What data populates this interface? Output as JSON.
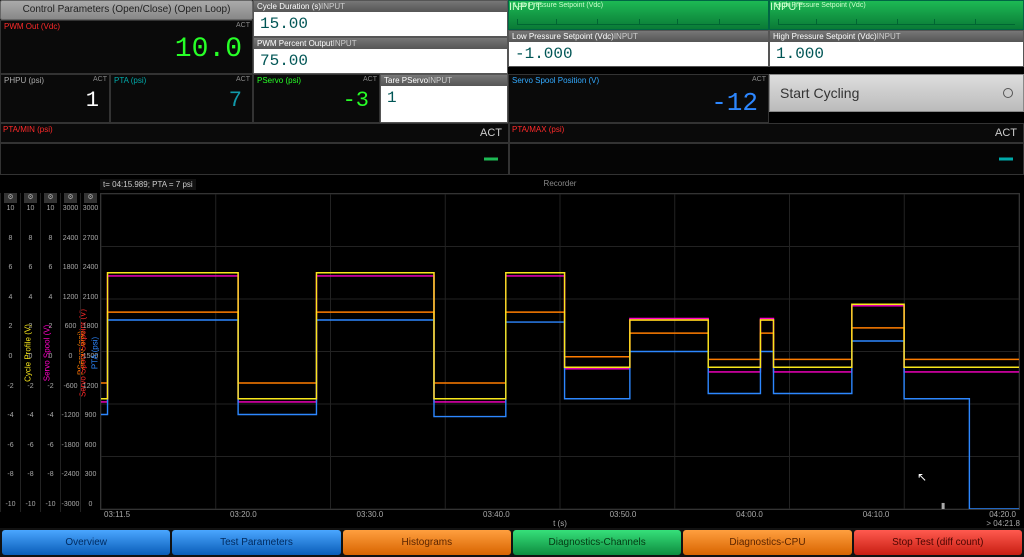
{
  "header_button": "Control Parameters (Open/Close) (Open Loop)",
  "panels": {
    "pwm_out": {
      "label": "PWM Out (Vdc)",
      "tag": "ACT",
      "value": "10.0"
    },
    "cycle_duration": {
      "label": "Cycle Duration (s)",
      "tag": "INPUT",
      "value": "15.00"
    },
    "pwm_percent": {
      "label": "PWM Percent Output",
      "tag": "INPUT",
      "value": "75.00"
    },
    "lp_setpoint_top": {
      "label": "Low Pressure Setpoint (Vdc)",
      "tag": "INPUT"
    },
    "lp_setpoint_bot": {
      "label": "Low Pressure Setpoint (Vdc)",
      "tag": "INPUT",
      "value": "-1.000"
    },
    "hp_setpoint_top": {
      "label": "High Pressure Setpoint (Vdc)",
      "tag": "INPUT"
    },
    "hp_setpoint_bot": {
      "label": "High Pressure Setpoint (Vdc)",
      "tag": "INPUT",
      "value": "1.000"
    },
    "phpu": {
      "label": "PHPU (psi)",
      "tag": "ACT",
      "value": "1"
    },
    "pta": {
      "label": "PTA (psi)",
      "tag": "ACT",
      "value": "7"
    },
    "pservo": {
      "label": "PServo (psi)",
      "tag": "ACT",
      "value": "-3"
    },
    "tare_pservo": {
      "label": "Tare PServo",
      "tag": "INPUT",
      "value": "1"
    },
    "servo_spool": {
      "label": "Servo Spool Position (V)",
      "tag": "ACT",
      "value": "-12"
    },
    "start_cycling": "Start Cycling",
    "ptamin": {
      "label": "PTA/MIN (psi)",
      "tag": "ACT"
    },
    "ptamax": {
      "label": "PTA/MAX (psi)",
      "tag": "ACT"
    }
  },
  "nav": [
    "Overview",
    "Test Parameters",
    "Histograms",
    "Diagnostics-Channels",
    "Diagnostics-CPU",
    "Stop Test (diff count)"
  ],
  "recorder": {
    "title": "Recorder",
    "cursor_label": "t= 04:15.989; PTA = 7 psi",
    "xlabel": "t (s)",
    "x_ticks": [
      "03:11.5",
      "03:20.0",
      "03:30.0",
      "03:40.0",
      "03:50.0",
      "04:00.0",
      "04:10.0",
      "04:20.0"
    ],
    "x_end": "> 04:21.8",
    "side_channels": [
      {
        "name": "Cycle Profile (V)",
        "color": "#f8e71c",
        "ticks": [
          "10",
          "8",
          "6",
          "4",
          "2",
          "0",
          "-2",
          "-4",
          "-6",
          "-8",
          "-10"
        ]
      },
      {
        "name": "Servo Spool (V)",
        "color": "#ff00c8",
        "ticks": [
          "10",
          "8",
          "6",
          "4",
          "2",
          "0",
          "-2",
          "-4",
          "-6",
          "-8",
          "-10"
        ]
      },
      {
        "name": "Servo Spool Setpoint (V)",
        "color": "#ff2a2a",
        "ticks": [
          "10",
          "8",
          "6",
          "4",
          "2",
          "0",
          "-2",
          "-4",
          "-6",
          "-8",
          "-10"
        ]
      },
      {
        "name": "PServo (psi)",
        "color": "#ff7d00",
        "ticks": [
          "3000",
          "2400",
          "1800",
          "1200",
          "600",
          "0",
          "-600",
          "-1200",
          "-1800",
          "-2400",
          "-3000"
        ]
      },
      {
        "name": "PTA (psi)",
        "color": "#2d87ff",
        "ticks": [
          "3000",
          "2700",
          "2400",
          "2100",
          "1800",
          "1500",
          "1200",
          "900",
          "600",
          "300",
          "0"
        ]
      }
    ]
  },
  "colors": {
    "bar_green": "#1db954",
    "bar_teal": "#0aa"
  },
  "chart_data": {
    "type": "line",
    "title": "Recorder",
    "xlabel": "t (s)",
    "xlim": [
      191.5,
      261.8
    ],
    "series": [
      {
        "name": "Cycle Profile (V)",
        "color": "#f8e71c",
        "ylim": [
          -10,
          10
        ],
        "points": [
          [
            191.5,
            -3
          ],
          [
            192,
            5
          ],
          [
            201,
            5
          ],
          [
            202,
            -3
          ],
          [
            207,
            -3
          ],
          [
            208,
            5
          ],
          [
            216,
            5
          ],
          [
            217,
            -3
          ],
          [
            221.5,
            -3
          ],
          [
            222.5,
            5
          ],
          [
            226,
            5
          ],
          [
            227,
            -1
          ],
          [
            231,
            -1
          ],
          [
            232,
            2
          ],
          [
            237,
            2
          ],
          [
            238,
            -1
          ],
          [
            242,
            2
          ],
          [
            243,
            -1
          ],
          [
            248,
            -1
          ],
          [
            249,
            3
          ],
          [
            252,
            3
          ],
          [
            253,
            -1
          ],
          [
            261.8,
            -1
          ]
        ]
      },
      {
        "name": "PTA (psi)",
        "color": "#2d87ff",
        "ylim": [
          0,
          3000
        ],
        "points": [
          [
            191.5,
            900
          ],
          [
            192,
            1800
          ],
          [
            201,
            1800
          ],
          [
            202,
            900
          ],
          [
            207,
            900
          ],
          [
            208,
            1800
          ],
          [
            216,
            1800
          ],
          [
            217,
            880
          ],
          [
            221.5,
            880
          ],
          [
            222.5,
            1780
          ],
          [
            226,
            1780
          ],
          [
            227,
            1050
          ],
          [
            231,
            1050
          ],
          [
            232,
            1500
          ],
          [
            237,
            1500
          ],
          [
            238,
            1100
          ],
          [
            242,
            1500
          ],
          [
            243,
            1100
          ],
          [
            248,
            1100
          ],
          [
            249,
            1600
          ],
          [
            252,
            1600
          ],
          [
            253,
            1050
          ],
          [
            255.989,
            1050
          ],
          [
            258,
            0
          ],
          [
            261.8,
            0
          ]
        ]
      },
      {
        "name": "PServo (psi)",
        "color": "#ff7d00",
        "ylim": [
          -3000,
          3000
        ],
        "points": [
          [
            191.5,
            -600
          ],
          [
            192,
            750
          ],
          [
            201,
            750
          ],
          [
            202,
            -600
          ],
          [
            207,
            -600
          ],
          [
            208,
            750
          ],
          [
            216,
            750
          ],
          [
            217,
            -600
          ],
          [
            221.5,
            -600
          ],
          [
            222.5,
            750
          ],
          [
            226,
            750
          ],
          [
            227,
            -100
          ],
          [
            231,
            -100
          ],
          [
            232,
            350
          ],
          [
            237,
            350
          ],
          [
            238,
            -150
          ],
          [
            242,
            350
          ],
          [
            243,
            -150
          ],
          [
            248,
            -150
          ],
          [
            249,
            450
          ],
          [
            252,
            450
          ],
          [
            253,
            -150
          ],
          [
            261.8,
            -150
          ]
        ]
      },
      {
        "name": "Servo Spool (V)",
        "color": "#ff00c8",
        "ylim": [
          -10,
          10
        ],
        "points": [
          [
            191.5,
            -3.2
          ],
          [
            192,
            4.8
          ],
          [
            201,
            4.8
          ],
          [
            202,
            -3.2
          ],
          [
            207,
            -3.2
          ],
          [
            208,
            4.8
          ],
          [
            216,
            4.8
          ],
          [
            217,
            -3.2
          ],
          [
            221.5,
            -3.2
          ],
          [
            222.5,
            4.8
          ],
          [
            226,
            4.8
          ],
          [
            227,
            -1.1
          ],
          [
            231,
            -1.1
          ],
          [
            232,
            2.1
          ],
          [
            237,
            2.1
          ],
          [
            238,
            -1.3
          ],
          [
            242,
            2.1
          ],
          [
            243,
            -1.3
          ],
          [
            248,
            -1.3
          ],
          [
            249,
            2.9
          ],
          [
            252,
            2.9
          ],
          [
            253,
            -1.3
          ],
          [
            261.8,
            -1.3
          ]
        ]
      },
      {
        "name": "Servo Spool Setpoint (V)",
        "color": "#ff2a2a",
        "ylim": [
          -10,
          10
        ],
        "points": [
          [
            191.5,
            -3
          ],
          [
            192,
            5
          ],
          [
            201,
            5
          ],
          [
            202,
            -3
          ],
          [
            207,
            -3
          ],
          [
            208,
            5
          ],
          [
            216,
            5
          ],
          [
            217,
            -3
          ],
          [
            221.5,
            -3
          ],
          [
            222.5,
            5
          ],
          [
            226,
            5
          ],
          [
            227,
            -1
          ],
          [
            231,
            -1
          ],
          [
            232,
            2
          ],
          [
            237,
            2
          ],
          [
            238,
            -1
          ],
          [
            242,
            2
          ],
          [
            243,
            -1
          ],
          [
            248,
            -1
          ],
          [
            249,
            3
          ],
          [
            252,
            3
          ],
          [
            253,
            -1
          ],
          [
            261.8,
            -1
          ]
        ]
      }
    ]
  }
}
